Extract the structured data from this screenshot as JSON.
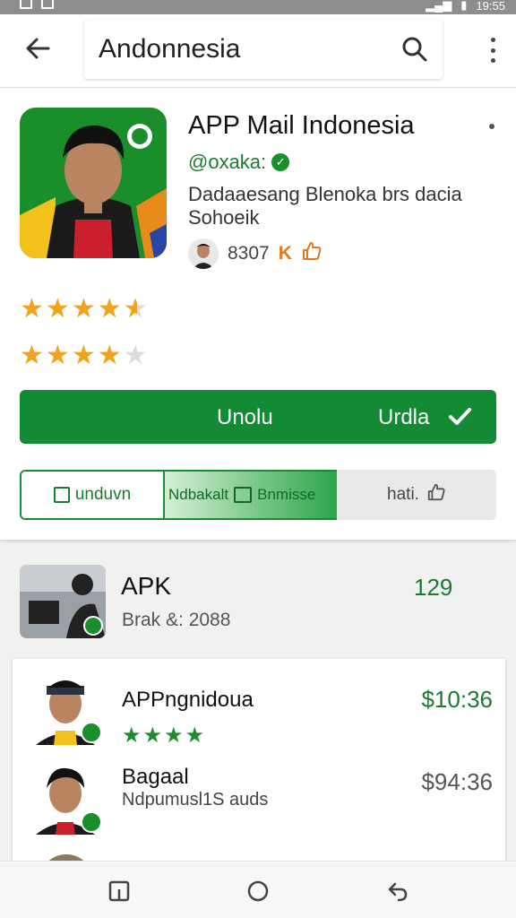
{
  "status_bar": {
    "time": "19:55"
  },
  "search": {
    "query": "Andonnesia"
  },
  "app": {
    "title": "APP Mail Indonesia",
    "developer": "@oxaka:",
    "description_line1": "Dadaaesang Blenoka brs dacia",
    "description_line2": "Sohoeik",
    "meta_count": "8307",
    "meta_k": "K",
    "rating_primary": 4.5,
    "rating_secondary": 4.0,
    "install_label_1": "Unolu",
    "install_label_2": "Urdla",
    "seg1_label": "unduvn",
    "seg2_label_a": "Ndbakalt",
    "seg2_label_b": "Bnmisse",
    "seg3_label": "hati.",
    "colors": {
      "primary_green": "#138b35",
      "star_orange": "#f3a21b"
    }
  },
  "apk_row": {
    "name": "APK",
    "subtitle": "Brak &: 2088",
    "price": "129"
  },
  "list_items": [
    {
      "name": "APPngnidoua",
      "rating": 4,
      "price": "$10:36",
      "price_color": "#1b7b2f"
    },
    {
      "name": "Bagaal",
      "subtitle": "Ndpumusl1S auds",
      "price": "$94:36",
      "price_color": "#555555"
    }
  ],
  "icons": [
    "back-arrow-icon",
    "search-icon",
    "more-vert-icon",
    "verified-icon",
    "check-icon",
    "recents-icon",
    "home-icon",
    "back-nav-icon"
  ]
}
